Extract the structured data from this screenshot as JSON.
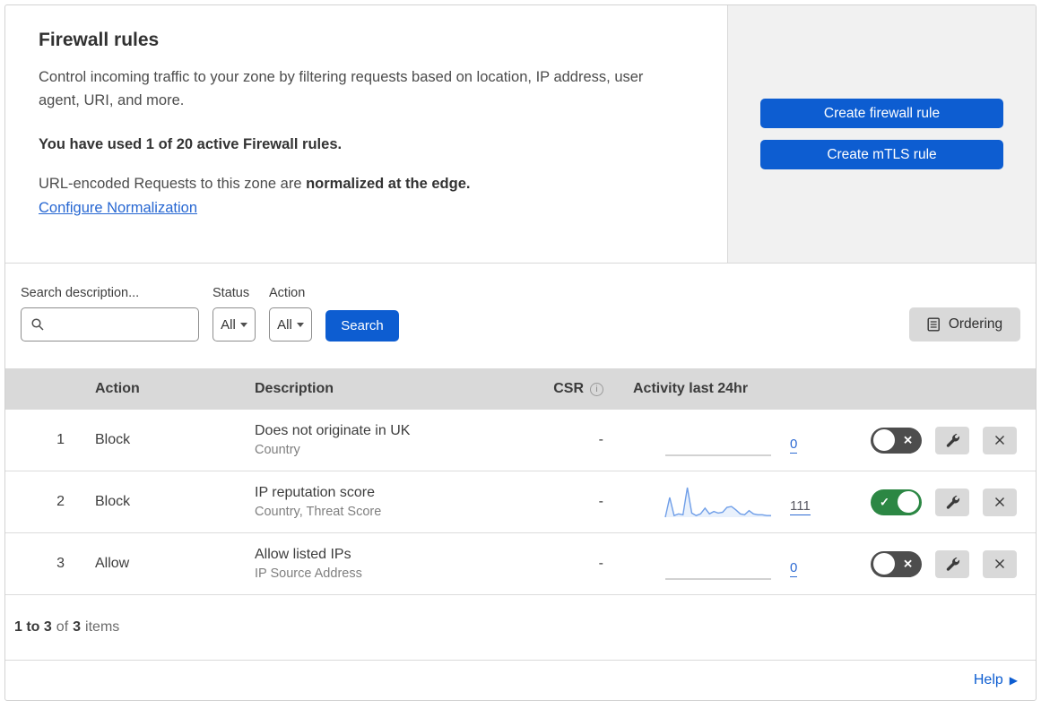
{
  "header": {
    "title": "Firewall rules",
    "description": "Control incoming traffic to your zone by filtering requests based on location, IP address, user agent, URI, and more.",
    "usage_note": "You have used 1 of 20 active Firewall rules.",
    "normalization_prefix": "URL-encoded Requests to this zone are ",
    "normalization_bold": "normalized at the edge.",
    "normalization_link": "Configure Normalization",
    "buttons": {
      "create_firewall_rule": "Create firewall rule",
      "create_mtls_rule": "Create mTLS rule"
    }
  },
  "filters": {
    "search_label": "Search description...",
    "search_value": "",
    "status_label": "Status",
    "status_value": "All",
    "action_label": "Action",
    "action_value": "All",
    "search_button": "Search",
    "ordering_button": "Ordering"
  },
  "table": {
    "columns": {
      "action": "Action",
      "description": "Description",
      "csr": "CSR",
      "activity": "Activity last 24hr"
    },
    "rows": [
      {
        "priority": "1",
        "action": "Block",
        "description": "Does not originate in UK",
        "fields": "Country",
        "csr": "-",
        "activity_count": "0",
        "count_muted": false,
        "enabled": false,
        "sparkline": [
          0,
          0,
          0,
          0,
          0,
          0,
          0,
          0,
          0,
          0,
          0,
          0,
          0,
          0,
          0,
          0,
          0,
          0,
          0,
          0,
          0,
          0,
          0,
          0,
          0
        ]
      },
      {
        "priority": "2",
        "action": "Block",
        "description": "IP reputation score",
        "fields": "Country, Threat Score",
        "csr": "-",
        "activity_count": "111",
        "count_muted": true,
        "enabled": true,
        "sparkline": [
          0,
          24,
          2,
          4,
          3,
          36,
          5,
          2,
          4,
          11,
          4,
          7,
          5,
          6,
          12,
          13,
          9,
          4,
          3,
          8,
          4,
          3,
          3,
          2,
          2
        ]
      },
      {
        "priority": "3",
        "action": "Allow",
        "description": "Allow listed IPs",
        "fields": "IP Source Address",
        "csr": "-",
        "activity_count": "0",
        "count_muted": false,
        "enabled": false,
        "sparkline": [
          0,
          0,
          0,
          0,
          0,
          0,
          0,
          0,
          0,
          0,
          0,
          0,
          0,
          0,
          0,
          0,
          0,
          0,
          0,
          0,
          0,
          0,
          0,
          0,
          0
        ]
      }
    ]
  },
  "footer": {
    "range": "1 to 3",
    "of": "of",
    "total": "3",
    "items": "items",
    "help": "Help"
  },
  "icons": {
    "check": "✓",
    "cross": "✕",
    "info": "i",
    "help_arrow": "▶"
  },
  "colors": {
    "primary_blue": "#0d5dd1",
    "link_blue": "#2e6bd3",
    "toggle_on_green": "#2c8744",
    "toggle_off_gray": "#4d4d4d",
    "sparkline_blue": "#6f9ee8",
    "table_header_gray": "#d9d9d9",
    "panel_gray": "#f1f1f1"
  }
}
